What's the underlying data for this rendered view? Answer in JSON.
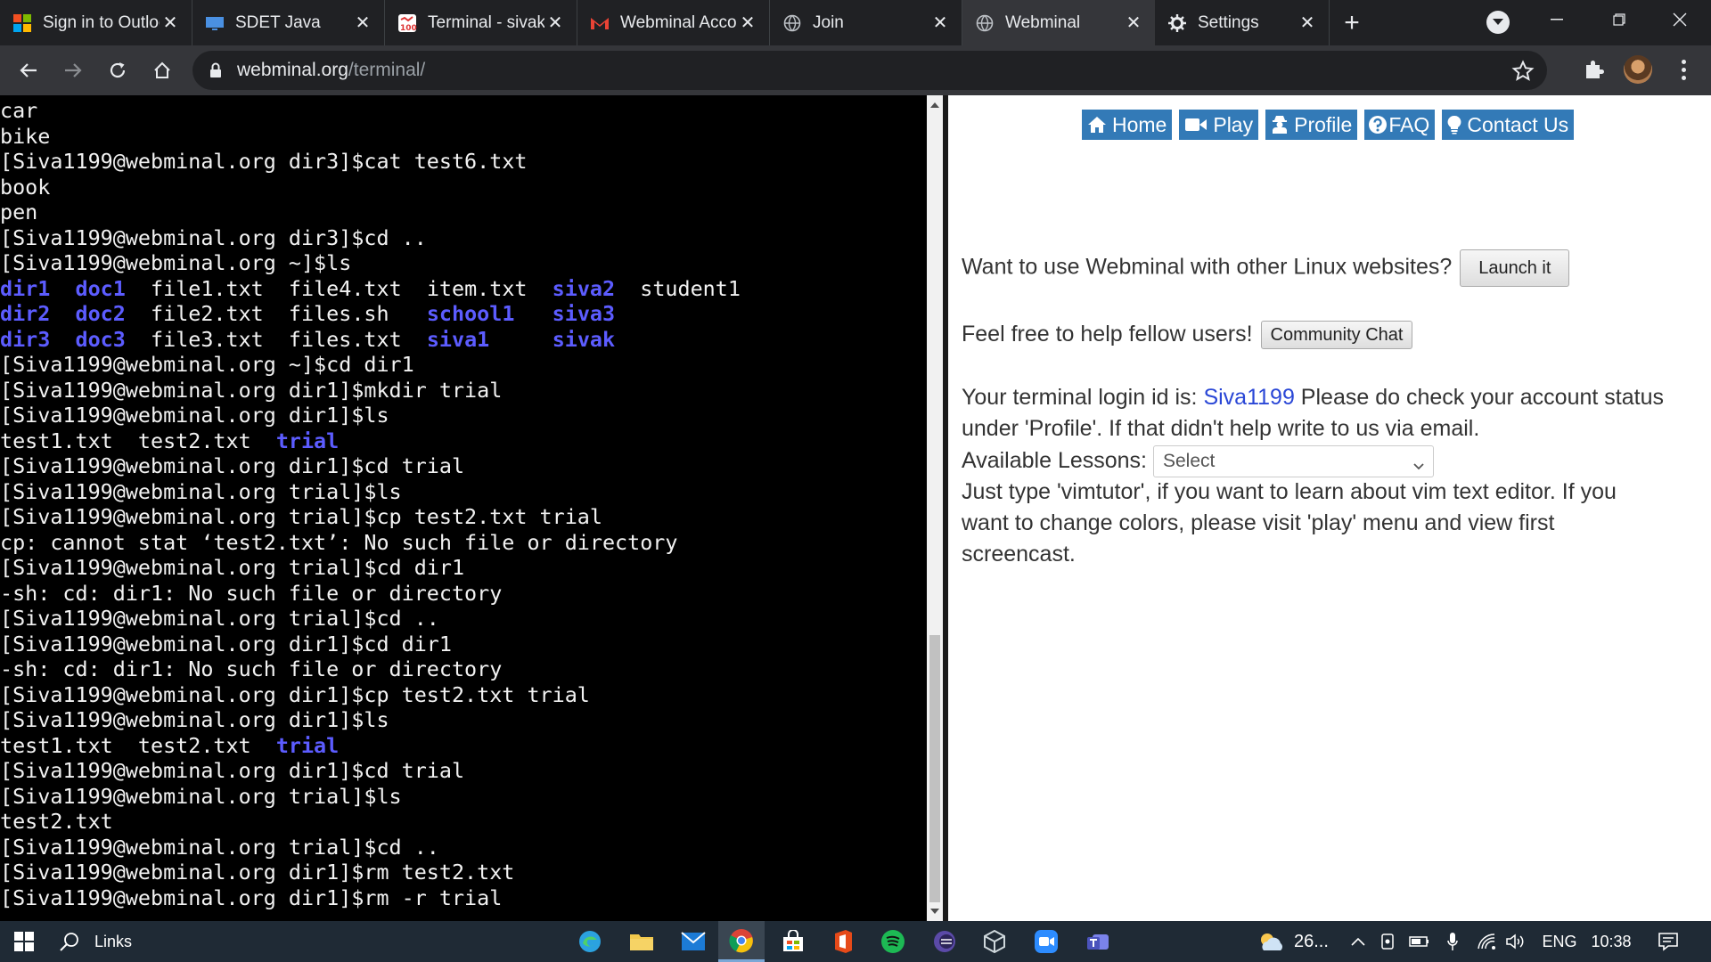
{
  "browser": {
    "tabs": [
      {
        "title": "Sign in to Outlook",
        "icon": "microsoft-icon"
      },
      {
        "title": "SDET Java",
        "icon": "monitor-icon"
      },
      {
        "title": "Terminal - sivak",
        "icon": "terminal-100-icon"
      },
      {
        "title": "Webminal Account",
        "icon": "gmail-icon"
      },
      {
        "title": "Join",
        "icon": "globe-icon"
      },
      {
        "title": "Webminal",
        "icon": "globe-icon"
      },
      {
        "title": "Settings",
        "icon": "gear-icon"
      }
    ],
    "url_host": "webminal.org",
    "url_path": "/terminal/"
  },
  "terminal": {
    "lines": [
      [
        "car"
      ],
      [
        "bike"
      ],
      [
        "[Siva1199@webminal.org dir3]$cat test6.txt"
      ],
      [
        "book"
      ],
      [
        "pen"
      ],
      [
        "[Siva1199@webminal.org dir3]$cd .."
      ],
      [
        "[Siva1199@webminal.org ~]$ls"
      ],
      [
        {
          "t": "dir1",
          "d": 1
        },
        "  ",
        {
          "t": "doc1",
          "d": 1
        },
        "  file1.txt  file4.txt  item.txt  ",
        {
          "t": "siva2",
          "d": 1
        },
        "  student1"
      ],
      [
        {
          "t": "dir2",
          "d": 1
        },
        "  ",
        {
          "t": "doc2",
          "d": 1
        },
        "  file2.txt  files.sh   ",
        {
          "t": "school1",
          "d": 1
        },
        "   ",
        {
          "t": "siva3",
          "d": 1
        }
      ],
      [
        {
          "t": "dir3",
          "d": 1
        },
        "  ",
        {
          "t": "doc3",
          "d": 1
        },
        "  file3.txt  files.txt  ",
        {
          "t": "siva1",
          "d": 1
        },
        "     ",
        {
          "t": "sivak",
          "d": 1
        }
      ],
      [
        "[Siva1199@webminal.org ~]$cd dir1"
      ],
      [
        "[Siva1199@webminal.org dir1]$mkdir trial"
      ],
      [
        "[Siva1199@webminal.org dir1]$ls"
      ],
      [
        "test1.txt  test2.txt  ",
        {
          "t": "trial",
          "d": 1
        }
      ],
      [
        "[Siva1199@webminal.org dir1]$cd trial"
      ],
      [
        "[Siva1199@webminal.org trial]$ls"
      ],
      [
        "[Siva1199@webminal.org trial]$cp test2.txt trial"
      ],
      [
        "cp: cannot stat ‘test2.txt’: No such file or directory"
      ],
      [
        "[Siva1199@webminal.org trial]$cd dir1"
      ],
      [
        "-sh: cd: dir1: No such file or directory"
      ],
      [
        "[Siva1199@webminal.org trial]$cd .."
      ],
      [
        "[Siva1199@webminal.org dir1]$cd dir1"
      ],
      [
        "-sh: cd: dir1: No such file or directory"
      ],
      [
        "[Siva1199@webminal.org dir1]$cp test2.txt trial"
      ],
      [
        "[Siva1199@webminal.org dir1]$ls"
      ],
      [
        "test1.txt  test2.txt  ",
        {
          "t": "trial",
          "d": 1
        }
      ],
      [
        "[Siva1199@webminal.org dir1]$cd trial"
      ],
      [
        "[Siva1199@webminal.org trial]$ls"
      ],
      [
        "test2.txt"
      ],
      [
        "[Siva1199@webminal.org trial]$cd .."
      ],
      [
        "[Siva1199@webminal.org dir1]$rm test2.txt"
      ],
      [
        "[Siva1199@webminal.org dir1]$rm -r trial"
      ]
    ]
  },
  "site": {
    "nav": {
      "home": "Home",
      "play": "Play",
      "profile": "Profile",
      "faq": "FAQ",
      "contact": "Contact Us"
    },
    "launch_text": "Want to use Webminal with other Linux websites?",
    "launch_button": "Launch it",
    "help_text": "Feel free to help fellow users!",
    "chat_button": "Community Chat",
    "login_prefix": "Your terminal login id is:",
    "login_id": "Siva1199",
    "login_suffix": " Please do check your account status",
    "login_line2": "under 'Profile'. If that didn't help write to us via email.",
    "lessons_label": "Available Lessons:",
    "lessons_selected": "Select",
    "vim_line1": "Just type 'vimtutor', if you want to learn about vim text editor. If you",
    "vim_line2": "want to change colors, please visit 'play' menu and view first",
    "vim_line3": "screencast.",
    "brand_color": "#337ab7"
  },
  "taskbar": {
    "search_label": "Links",
    "weather": "26...",
    "language": "ENG",
    "time": "10:38"
  }
}
